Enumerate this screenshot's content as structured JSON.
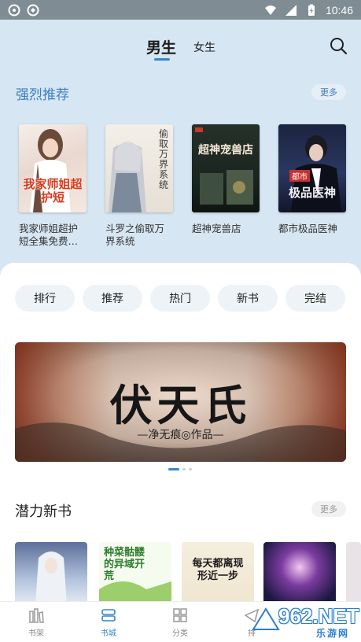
{
  "status_bar": {
    "time": "10:46"
  },
  "header": {
    "tabs": [
      {
        "label": "男生",
        "selected": true
      },
      {
        "label": "女生",
        "selected": false
      }
    ],
    "search_icon": "search-icon"
  },
  "recommend": {
    "title": "强烈推荐",
    "more_label": "更多",
    "books": [
      {
        "title": "我家师姐超护短全集免费…",
        "cover_text": "我家师姐超护短"
      },
      {
        "title": "斗罗之偷取万界系统",
        "cover_text": "偷取万界系统"
      },
      {
        "title": "超神宠兽店",
        "cover_text": "超神宠兽店"
      },
      {
        "title": "都市极品医神",
        "cover_text": "极品医神",
        "cover_tag": "都市"
      }
    ]
  },
  "categories": [
    "排行",
    "推荐",
    "热门",
    "新书",
    "完结"
  ],
  "banner": {
    "title": "伏天氏",
    "subtitle": "—净无痕◎作品—",
    "pages": 3,
    "active_page": 1
  },
  "new_books": {
    "title": "潜力新书",
    "more_label": "更多",
    "covers": [
      {
        "cover_text": ""
      },
      {
        "cover_text": "种菜骷髅的异域开荒"
      },
      {
        "cover_text": "每天都离现形近一步"
      },
      {
        "cover_text": ""
      }
    ]
  },
  "bottom_nav": [
    {
      "label": "书架",
      "icon": "bookshelf-icon",
      "active": false
    },
    {
      "label": "书城",
      "icon": "bookstore-icon",
      "active": true
    },
    {
      "label": "分类",
      "icon": "category-grid-icon",
      "active": false
    },
    {
      "label": "排",
      "icon": "ranking-icon",
      "active": false
    }
  ],
  "watermark": {
    "text": "962.NET",
    "sub": "乐游网"
  },
  "colors": {
    "accent": "#3a86cc",
    "top_background": "#d6e6f3",
    "section_title": "#3d7fbf"
  }
}
